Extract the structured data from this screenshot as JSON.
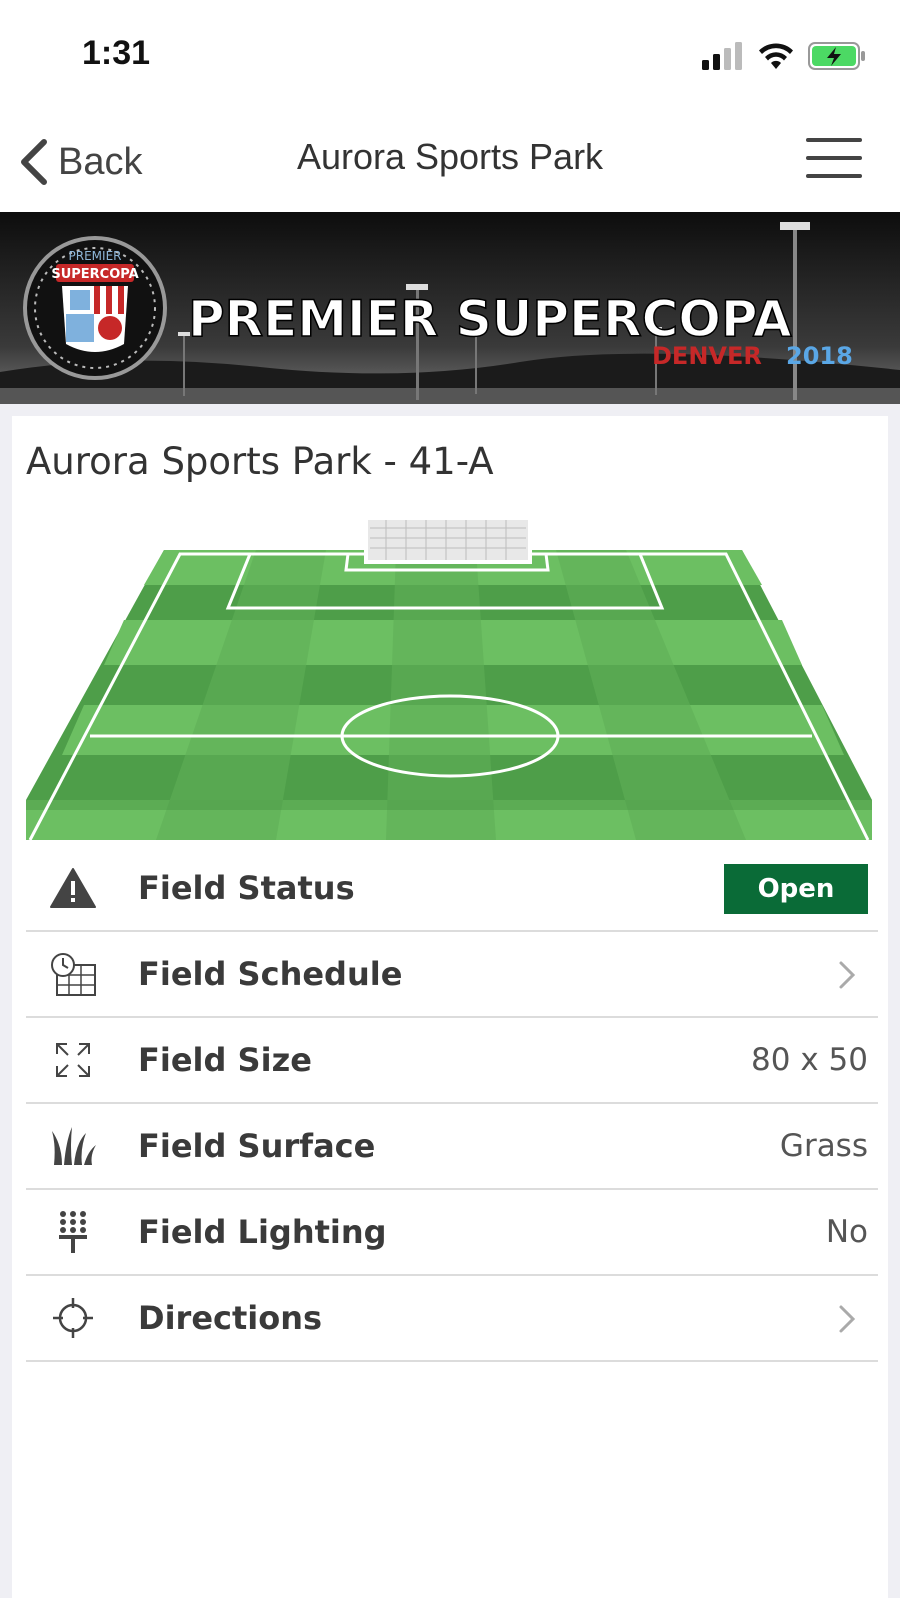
{
  "status_bar": {
    "time": "1:31"
  },
  "nav": {
    "back_label": "Back",
    "title": "Aurora Sports Park"
  },
  "banner": {
    "headline": "PREMIER SUPERCOPA",
    "city": "DENVER",
    "year": "2018",
    "logo_top_text": "PREMIER",
    "logo_main_text": "SUPERCOPA"
  },
  "card": {
    "title": "Aurora Sports Park - 41-A",
    "rows": [
      {
        "icon": "warning-icon",
        "label": "Field Status",
        "value": "Open",
        "kind": "badge"
      },
      {
        "icon": "calendar-clock-icon",
        "label": "Field Schedule",
        "value": "",
        "kind": "chevron"
      },
      {
        "icon": "expand-arrows-icon",
        "label": "Field Size",
        "value": "80 x 50",
        "kind": "text"
      },
      {
        "icon": "grass-icon",
        "label": "Field Surface",
        "value": "Grass",
        "kind": "text"
      },
      {
        "icon": "stadium-light-icon",
        "label": "Field Lighting",
        "value": "No",
        "kind": "text"
      },
      {
        "icon": "crosshair-icon",
        "label": "Directions",
        "value": "",
        "kind": "chevron"
      }
    ]
  },
  "colors": {
    "status_open": "#0a6b37",
    "pitch_light": "#6cbf62",
    "pitch_dark": "#4e9e49",
    "battery": "#4cd964"
  }
}
